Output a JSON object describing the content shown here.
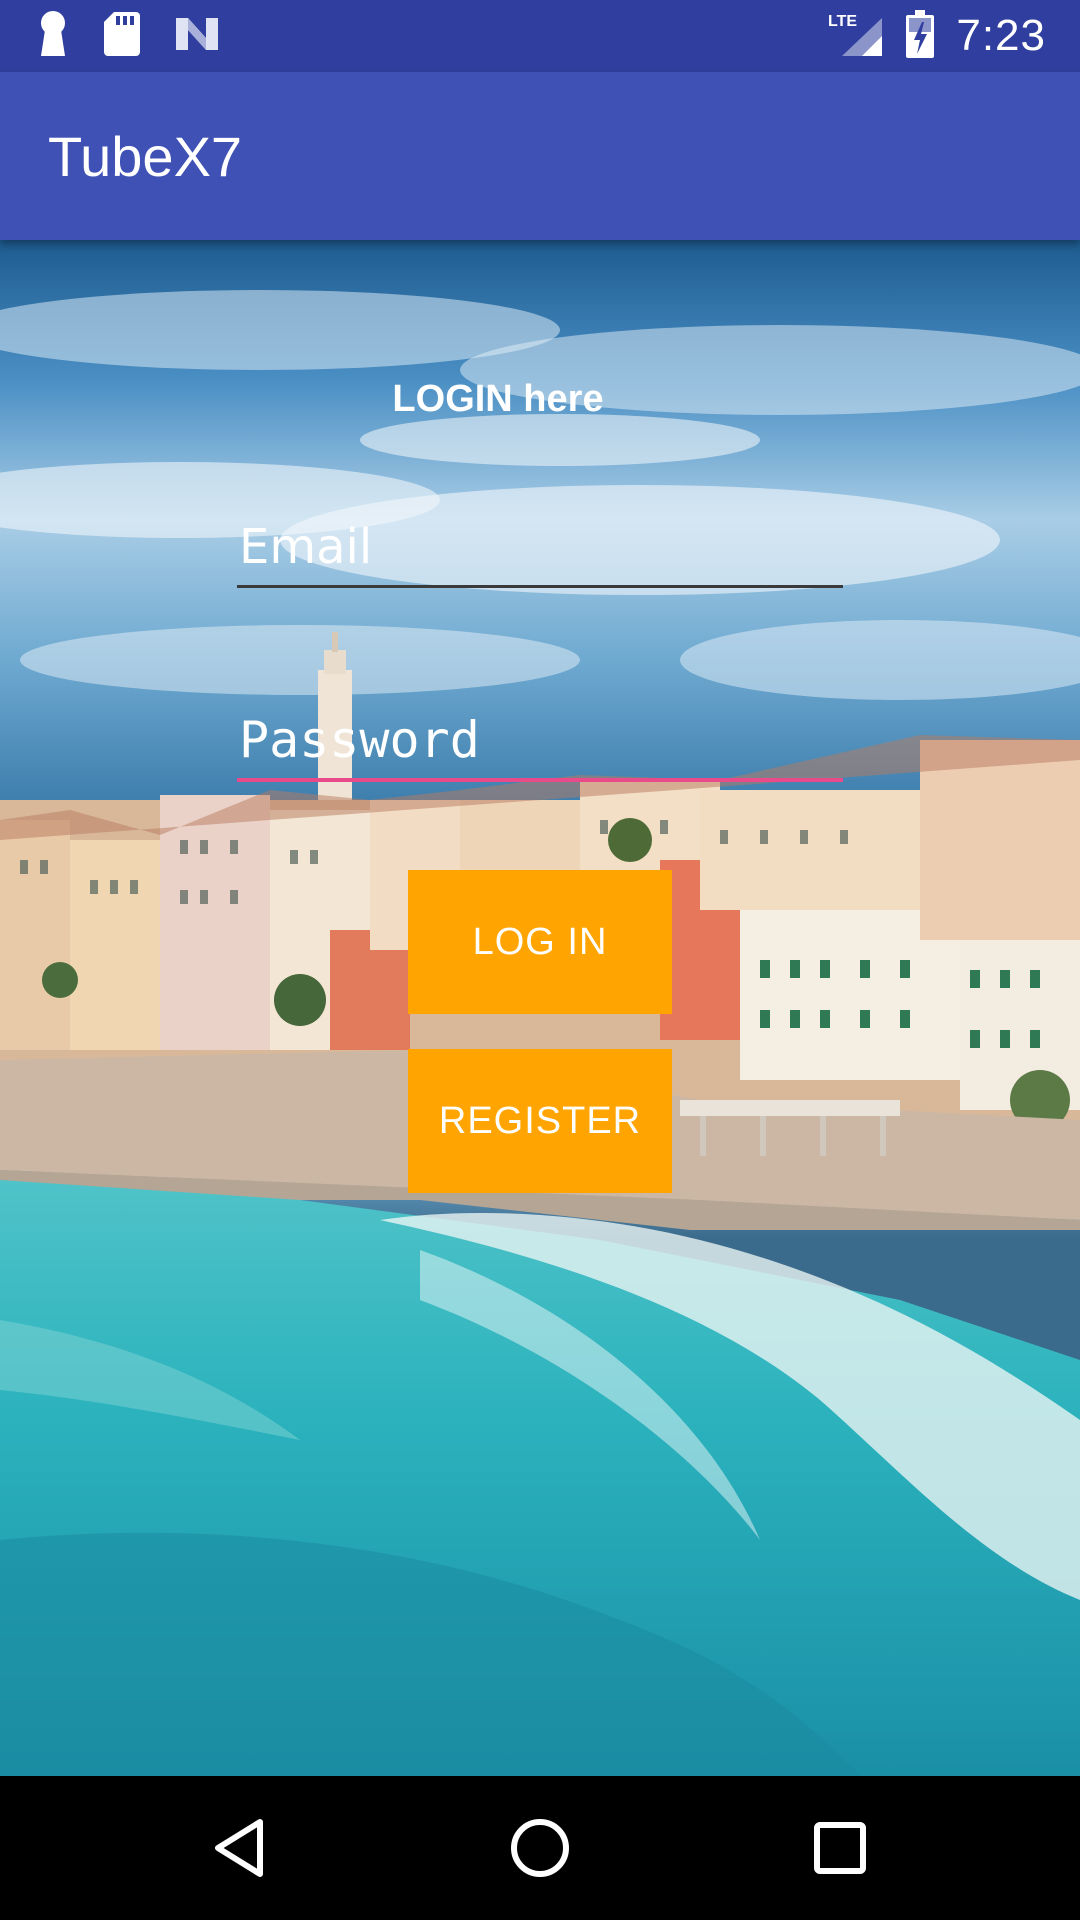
{
  "status_bar": {
    "time": "7:23",
    "network_label": "LTE",
    "icons": [
      "keyhole-icon",
      "sd-card-icon",
      "n-icon",
      "lte-signal-icon",
      "battery-charging-icon"
    ],
    "color": "#303f9f"
  },
  "app_bar": {
    "title": "TubeX7",
    "color": "#3f51b5"
  },
  "form": {
    "heading": "LOGIN here",
    "email": {
      "value": "",
      "placeholder": "Email"
    },
    "password": {
      "value": "",
      "placeholder": "Password",
      "focused": true
    },
    "login_label": "LOG IN",
    "register_label": "REGISTER",
    "button_color": "#ffa400",
    "focus_underline_color": "#e84a8a"
  },
  "nav_bar": {
    "icons": [
      "back-icon",
      "home-icon",
      "recents-icon"
    ]
  }
}
